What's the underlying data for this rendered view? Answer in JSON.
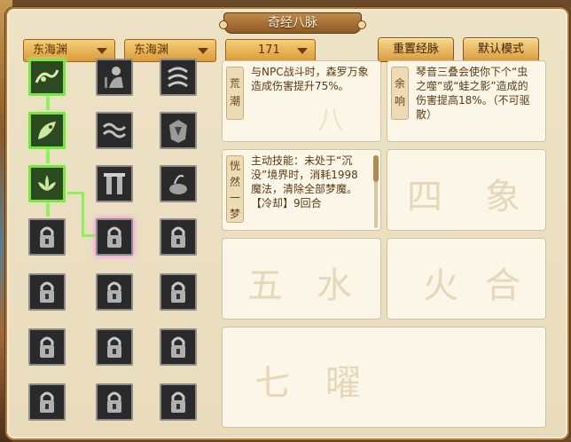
{
  "window": {
    "title": "奇经八脉"
  },
  "filters": {
    "school_1": "东海渊",
    "school_2": "东海渊",
    "level": "171"
  },
  "buttons": {
    "reset": "重置经脉",
    "default_mode": "默认模式"
  },
  "skills": {
    "active_count": 3,
    "locked_icon": "lock-icon",
    "colors": {
      "active_border": "#7ee04c",
      "locked_border": "#8c8c8c"
    }
  },
  "cards": [
    {
      "label": "荒潮",
      "text": "与NPC战斗时，森罗万象造成伤害提升75%。"
    },
    {
      "label": "余响",
      "text": "琴音三叠会使你下个“虫之噬”或“蛙之影”造成的伤害提高18%。（不可驱散）"
    },
    {
      "label": "恍然一梦",
      "text": "主动技能：未处于“沉没”境界时，消耗1998魔法，清除全部梦魔。【冷却】9回合"
    }
  ],
  "background_glyphs": [
    "八",
    "四",
    "象",
    "五",
    "水",
    "火",
    "合",
    "七",
    "曜"
  ]
}
